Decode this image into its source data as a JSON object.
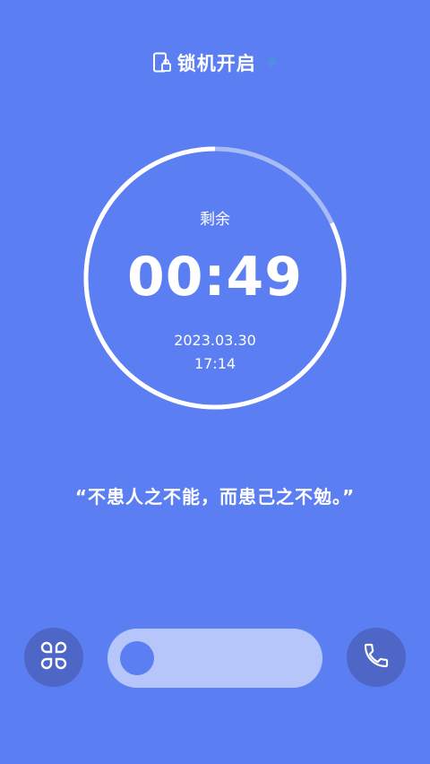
{
  "header": {
    "title": "锁机开启",
    "lock_icon": "phone-lock-icon",
    "status_icon": "snowflake-icon",
    "status_icon_color": "#4a9ad6"
  },
  "timer": {
    "label": "剩余",
    "remaining": "00:49",
    "date": "2023.03.30",
    "time": "17:14",
    "progress_fraction": 0.82
  },
  "quote": "“不患人之不能，而患己之不勉。”",
  "controls": {
    "apps_icon": "app-grid-icon",
    "phone_icon": "phone-icon",
    "slider_icon": "unlock-slider"
  },
  "colors": {
    "background": "#5b7ef2",
    "button": "#4e67c6",
    "track": "#b6c6fa",
    "ring_remaining": "#a7bcf6",
    "ring_main": "#ffffff"
  }
}
